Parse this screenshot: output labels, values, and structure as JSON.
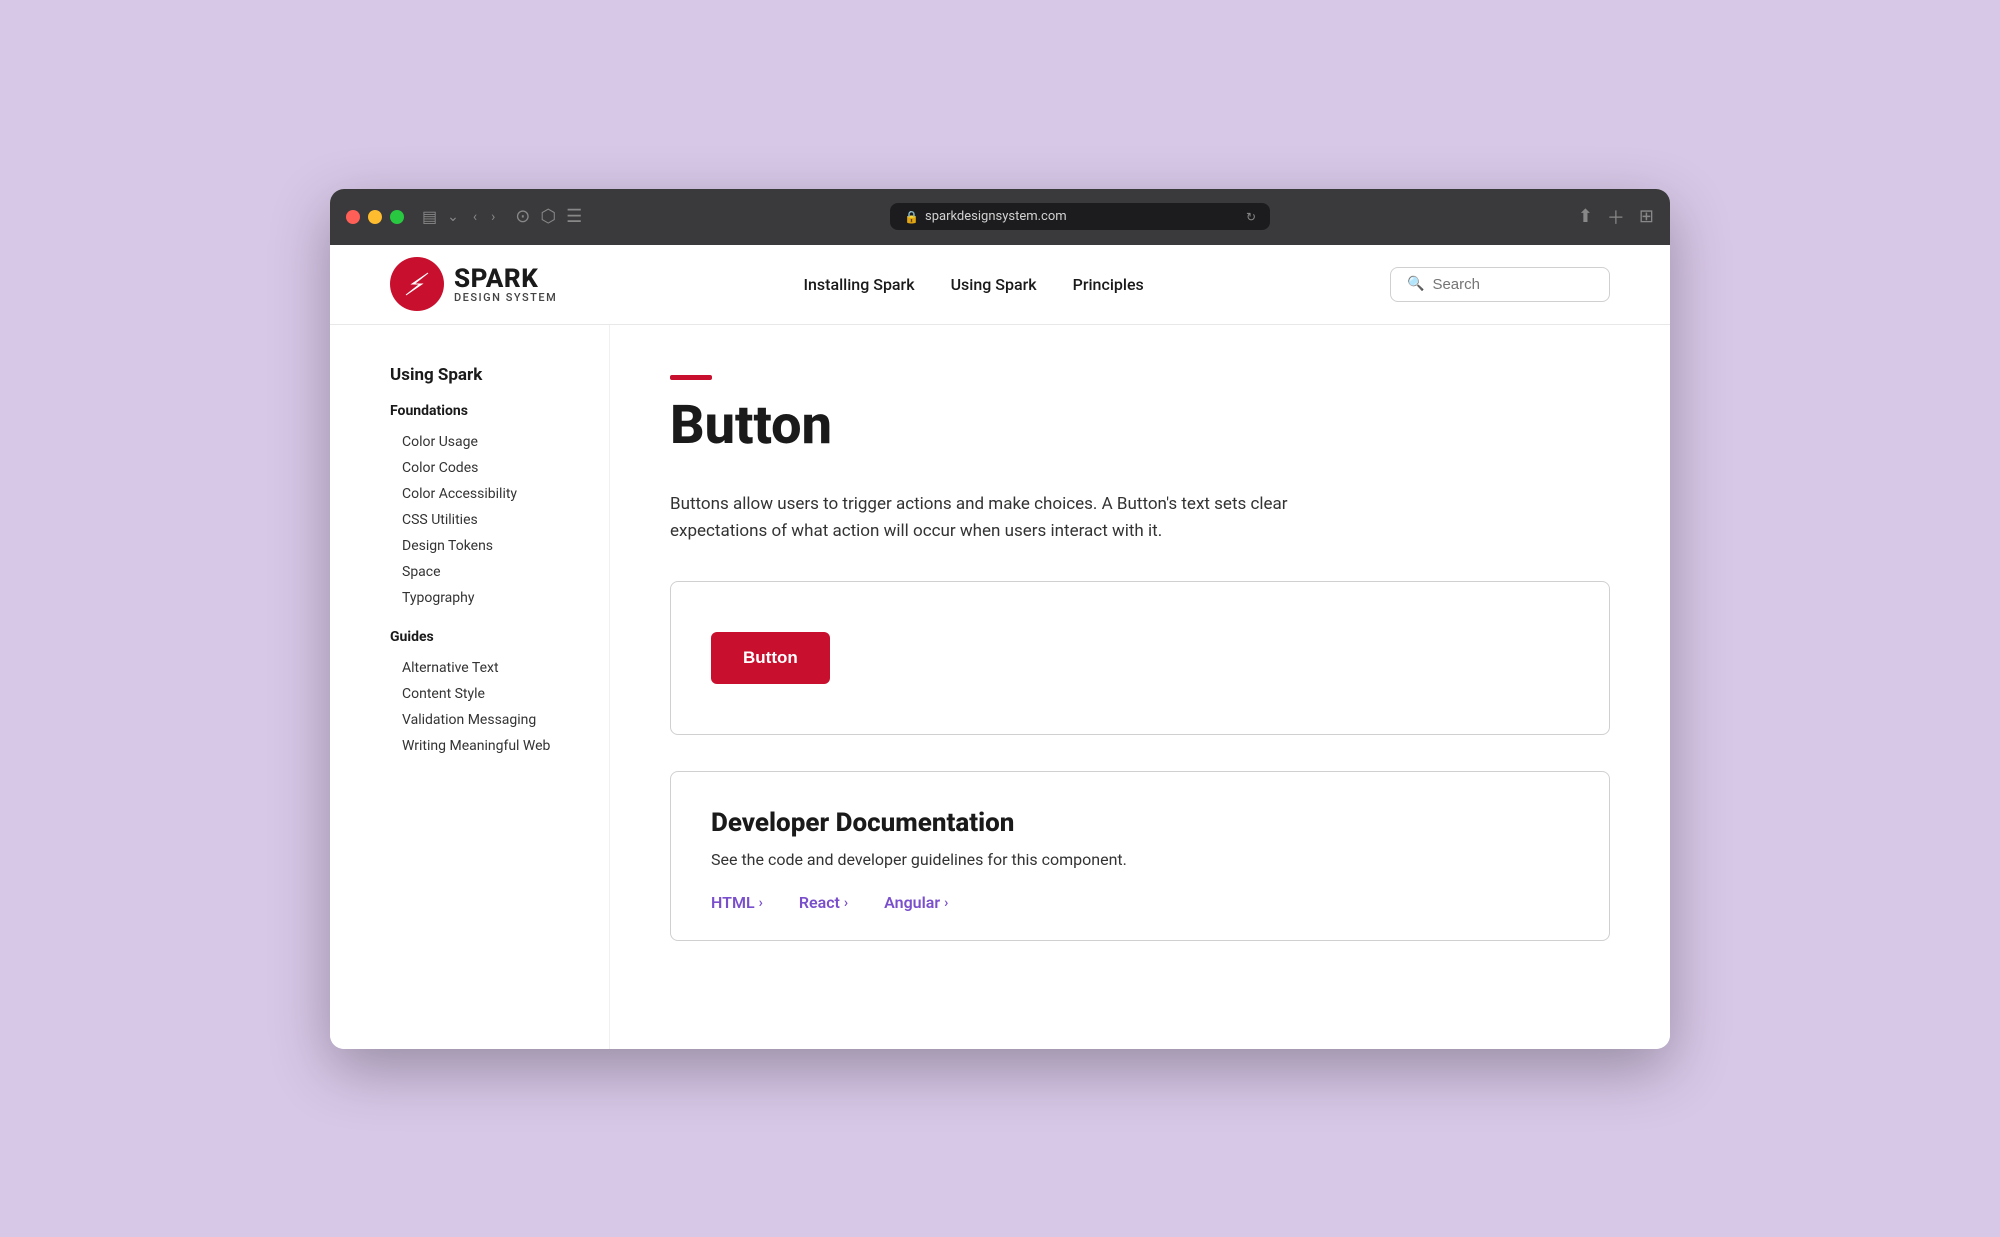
{
  "browser": {
    "url": "sparkdesignsystem.com",
    "refresh_icon": "↻"
  },
  "header": {
    "logo_spark": "SPARK",
    "logo_subtitle": "DESIGN SYSTEM",
    "nav": [
      {
        "label": "Installing Spark"
      },
      {
        "label": "Using Spark"
      },
      {
        "label": "Principles"
      }
    ],
    "search_placeholder": "Search"
  },
  "sidebar": {
    "section_title": "Using Spark",
    "groups": [
      {
        "label": "Foundations",
        "items": [
          "Color Usage",
          "Color Codes",
          "Color Accessibility",
          "CSS Utilities",
          "Design Tokens",
          "Space",
          "Typography"
        ]
      },
      {
        "label": "Guides",
        "items": [
          "Alternative Text",
          "Content Style",
          "Validation Messaging",
          "Writing Meaningful Web"
        ]
      }
    ]
  },
  "main": {
    "page_title": "Button",
    "page_description": "Buttons allow users to trigger actions and make choices. A Button's text sets clear expectations of what action will occur when users interact with it.",
    "demo_button_label": "Button",
    "dev_doc": {
      "title": "Developer Documentation",
      "description": "See the code and developer guidelines for this component.",
      "links": [
        {
          "label": "HTML",
          "href": "#"
        },
        {
          "label": "React",
          "href": "#"
        },
        {
          "label": "Angular",
          "href": "#"
        }
      ]
    }
  }
}
